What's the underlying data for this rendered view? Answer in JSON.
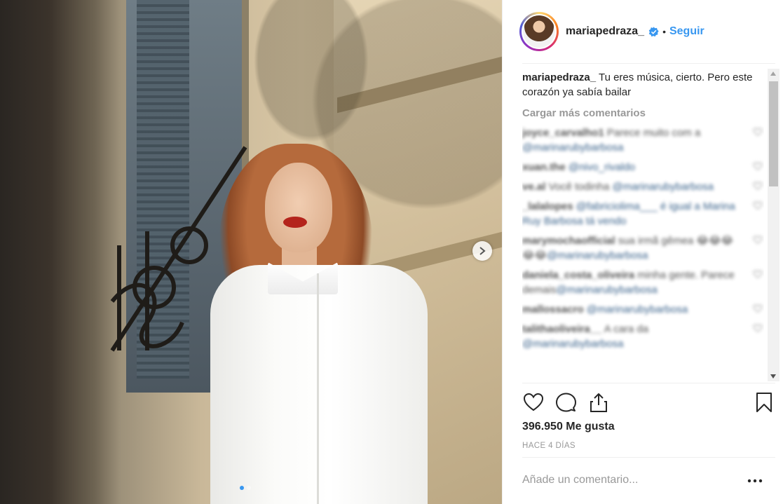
{
  "post": {
    "carousel": {
      "count": 2,
      "active_index": 0
    }
  },
  "header": {
    "username": "mariapedraza_",
    "separator": "•",
    "follow_label": "Seguir"
  },
  "caption": {
    "username": "mariapedraza_",
    "text": "Tu eres música, cierto. Pero este corazón ya sabía bailar"
  },
  "load_more_label": "Cargar más comentarios",
  "comments": [
    {
      "user": "joyce_carvalho1",
      "text": "Parece muito com a ",
      "mention": "@marinarubybarbosa"
    },
    {
      "user": "xuan.the",
      "text": "",
      "mention": "@nivo_rivaldo"
    },
    {
      "user": "ve.al",
      "text": "Você todinha ",
      "mention": "@marinarubybarbosa"
    },
    {
      "user": "_lalalopes",
      "text": "",
      "mention": "@fabriciolima___ é igual a Marina Ruy Barbosa tá vendo"
    },
    {
      "user": "marymochaofficial",
      "text": "sua irmã gêmea 😂😂😂😂😂",
      "mention": "@marinarubybarbosa"
    },
    {
      "user": "daniela_costa_oliveira",
      "text": "minha gente. Parece demais",
      "mention": "@marinarubybarbosa"
    },
    {
      "user": "mallossacro",
      "text": "",
      "mention": "@marinarubybarbosa"
    },
    {
      "user": "talithaoliveira__",
      "text": "A cara da ",
      "mention": "@marinarubybarbosa"
    }
  ],
  "actions": {
    "like_icon": "heart-icon",
    "comment_icon": "comment-icon",
    "share_icon": "share-icon",
    "save_icon": "bookmark-icon"
  },
  "likes_label": "396.950 Me gusta",
  "timestamp": "HACE 4 DÍAS",
  "comment_input": {
    "placeholder": "Añade un comentario..."
  },
  "more_options_label": "•••",
  "colors": {
    "link_blue": "#3897f0",
    "text_dark": "#262626",
    "text_muted": "#999999",
    "divider": "#efefef"
  }
}
